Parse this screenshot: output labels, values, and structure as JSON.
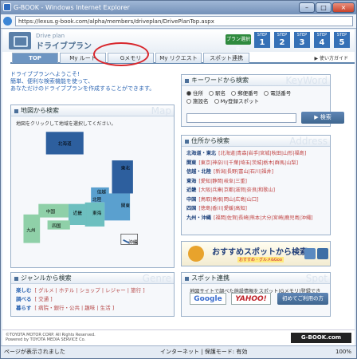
{
  "window": {
    "title": "G-BOOK - Windows Internet Explorer",
    "url": "https://lexus.g-book.com/alpha/members/driveplan/DrivePlanTop.aspx"
  },
  "header": {
    "subtitle": "Drive plan",
    "title": "ドライブプラン",
    "car_label": "プラン選択中",
    "steps": [
      {
        "cap": "STEP",
        "num": "1"
      },
      {
        "cap": "STEP",
        "num": "2"
      },
      {
        "cap": "STEP",
        "num": "3"
      },
      {
        "cap": "STEP",
        "num": "4"
      },
      {
        "cap": "STEP",
        "num": "5"
      }
    ]
  },
  "tabs": [
    {
      "label": "TOP"
    },
    {
      "label": "My ルート"
    },
    {
      "label": "Gメモリ"
    },
    {
      "label": "My リクエスト"
    },
    {
      "label": "スポット連携"
    }
  ],
  "howto": "▶ 使い方ガイド",
  "intro": {
    "l1": "ドライブプランへようこそ!",
    "l2": "簡単、便利な検索機能を使って、",
    "l3": "あなただけのドライブプランを作成することができます。"
  },
  "map_panel": {
    "title": "地図から検索",
    "ghost": "Map",
    "note": "地図をクリックして地域を選択してください。",
    "regions": [
      "北海道",
      "東北",
      "関東",
      "信越",
      "北陸",
      "東海",
      "近畿",
      "中国",
      "四国",
      "九州",
      "沖縄"
    ]
  },
  "keyword_panel": {
    "title": "キーワードから検索",
    "ghost": "KeyWord",
    "options": [
      "住所",
      "駅名",
      "郵便番号",
      "電話番号",
      "施設名",
      "My登録スポット"
    ],
    "button": "▶ 検索"
  },
  "address_panel": {
    "title": "住所から検索",
    "ghost": "Address",
    "rows": [
      {
        "region": "北海道・東北",
        "prefs": "[北海道|青森|岩手|宮城|秋田|山形|福島]"
      },
      {
        "region": "関東",
        "prefs": "[東京|神奈川|千葉|埼玉|茨城|栃木|群馬|山梨]"
      },
      {
        "region": "信越・北陸",
        "prefs": "[新潟|長野|富山|石川|福井]"
      },
      {
        "region": "東海",
        "prefs": "[愛知|静岡|岐阜|三重]"
      },
      {
        "region": "近畿",
        "prefs": "[大阪|兵庫|京都|滋賀|奈良|和歌山]"
      },
      {
        "region": "中国",
        "prefs": "[鳥取|島根|岡山|広島|山口]"
      },
      {
        "region": "四国",
        "prefs": "[徳島|香川|愛媛|高知]"
      },
      {
        "region": "九州・沖縄",
        "prefs": "[福岡|佐賀|長崎|熊本|大分|宮崎|鹿児島|沖縄]"
      }
    ]
  },
  "banner": {
    "title": "おすすめスポットから検索",
    "tag": "おすすめ・グルメ&Goo"
  },
  "genre_panel": {
    "title": "ジャンルから検索",
    "ghost": "Genre",
    "rows": [
      {
        "cat": "楽しむ",
        "items": "[ グルメ | ホテル | ショップ | レジャー | 旅行 ]"
      },
      {
        "cat": "調べる",
        "items": "[ 交通 ]"
      },
      {
        "cat": "暮らす",
        "items": "[ 病院・銀行・公共 | 趣味 | 生活 ]"
      }
    ]
  },
  "spot_panel": {
    "title": "スポット連携",
    "ghost": "Spot",
    "desc": "地図サイトで調べた施設情報をスポット(Gメモリ)登録できます。",
    "google": "Google",
    "yahoo": "YAHOO!",
    "first_btn": "初めてご利用の方"
  },
  "footer": {
    "copy1": "©TOYOTA MOTOR CORP. All Rights Reserved.",
    "copy2": "Powered by TOYOTA MEDIA SERVICE Co.",
    "brand": "G-BOOK.com"
  },
  "statusbar": {
    "text": "ページが表示されました",
    "zone": "インターネット | 保護モード: 有効",
    "zoom": "100%"
  }
}
